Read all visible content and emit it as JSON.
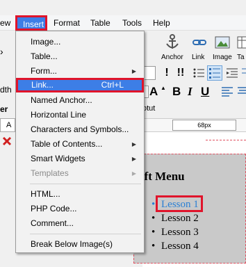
{
  "menubar": {
    "items": [
      {
        "label": "ew"
      },
      {
        "label": "Insert"
      },
      {
        "label": "Format"
      },
      {
        "label": "Table"
      },
      {
        "label": "Tools"
      },
      {
        "label": "Help"
      }
    ]
  },
  "toolbar": {
    "anchor_label": "Anchor",
    "link_label": "Link",
    "image_label": "Image",
    "table_label": "Ta"
  },
  "formatbar": {
    "excl1": "!",
    "excl2": "!!",
    "text_size": "A",
    "bold": "B",
    "italic": "I",
    "underline": "U"
  },
  "left_fragments": {
    "dth": "dth",
    "er": "er",
    "a": "A"
  },
  "ruler": {
    "label": "otut",
    "value": "68px"
  },
  "canvas": {
    "heading": "eft Menu",
    "lessons": [
      "Lesson 1",
      "Lesson 2",
      "Lesson 3",
      "Lesson 4"
    ]
  },
  "dropdown": {
    "items": [
      {
        "label": "Image...",
        "underline": "I"
      },
      {
        "label": "Table...",
        "underline": "T"
      },
      {
        "label": "Form...",
        "underline": "F",
        "submenu": true
      },
      {
        "label": "Link...",
        "underline": "L",
        "shortcut": "Ctrl+L"
      },
      {
        "label": "Named Anchor...",
        "underline": "N"
      },
      {
        "label": "Horizontal Line",
        "underline": "H"
      },
      {
        "label": "Characters and Symbols...",
        "underline": "C"
      },
      {
        "label": "Table of Contents...",
        "underline": "o",
        "submenu": true
      },
      {
        "label": "Smart Widgets",
        "underline": "S",
        "submenu": true
      },
      {
        "label": "Templates",
        "disabled": true,
        "submenu": true
      },
      {
        "label": "HTML...",
        "underline": "H"
      },
      {
        "label": "PHP Code...",
        "underline": "P"
      },
      {
        "label": "Comment...",
        "underline": "m"
      },
      {
        "label": "Break Below Image(s)",
        "underline": "k"
      }
    ]
  }
}
